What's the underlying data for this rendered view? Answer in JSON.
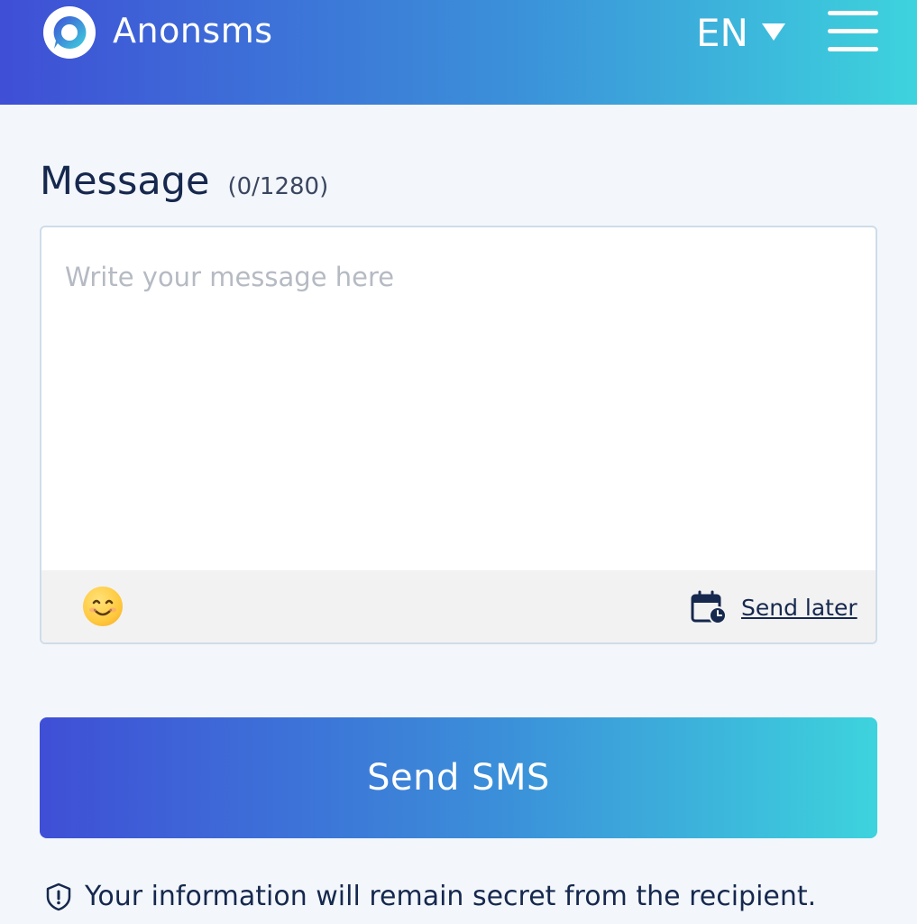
{
  "header": {
    "brand": "Anonsms",
    "language": "EN",
    "colors": {
      "gradient_start": "#3f4fd6",
      "gradient_mid": "#3b8fd9",
      "gradient_end": "#3dd3dd"
    }
  },
  "message": {
    "label": "Message",
    "counter": "(0/1280)",
    "value": "",
    "placeholder": "Write your message here",
    "emoji_icon": "smiling-face-emoji",
    "schedule_icon": "calendar-clock-icon",
    "send_later_label": "Send later"
  },
  "actions": {
    "send_label": "Send SMS"
  },
  "notice": {
    "icon": "shield-icon",
    "text": "Your information will remain secret from the recipient."
  }
}
